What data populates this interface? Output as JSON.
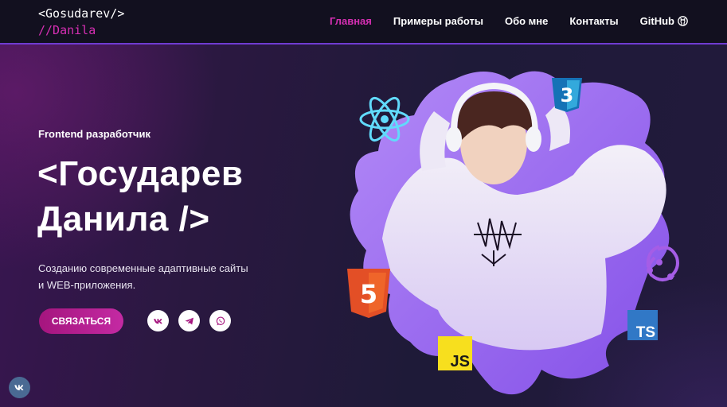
{
  "header": {
    "logo_line1": "<Gosudarev/>",
    "logo_line2": "//Danila",
    "nav": [
      {
        "label": "Главная",
        "active": true
      },
      {
        "label": "Примеры работы",
        "active": false
      },
      {
        "label": "Обо мне",
        "active": false
      },
      {
        "label": "Контакты",
        "active": false
      },
      {
        "label": "GitHub",
        "active": false,
        "icon": "github-icon"
      }
    ]
  },
  "hero": {
    "subtitle": "Frontend разработчик",
    "title_line1": "<Государев",
    "title_line2": "Данила />",
    "desc_line1": "Созданию современные адаптивные сайты",
    "desc_line2": "и WEB-приложения.",
    "cta_label": "СВЯЗАТЬСЯ",
    "socials": [
      "vk-icon",
      "telegram-icon",
      "whatsapp-icon"
    ],
    "tech_icons": [
      "react-icon",
      "css3-icon",
      "html5-icon",
      "javascript-icon",
      "typescript-icon",
      "redux-icon"
    ],
    "badges": {
      "css": "3",
      "html": "5",
      "js": "JS",
      "ts": "TS"
    }
  },
  "floating": {
    "icon": "vk-icon"
  },
  "colors": {
    "accent": "#d62fb3",
    "nav_border": "#6f3bd1",
    "blob": "#9a6cf2",
    "header_bg": "#12101f"
  }
}
